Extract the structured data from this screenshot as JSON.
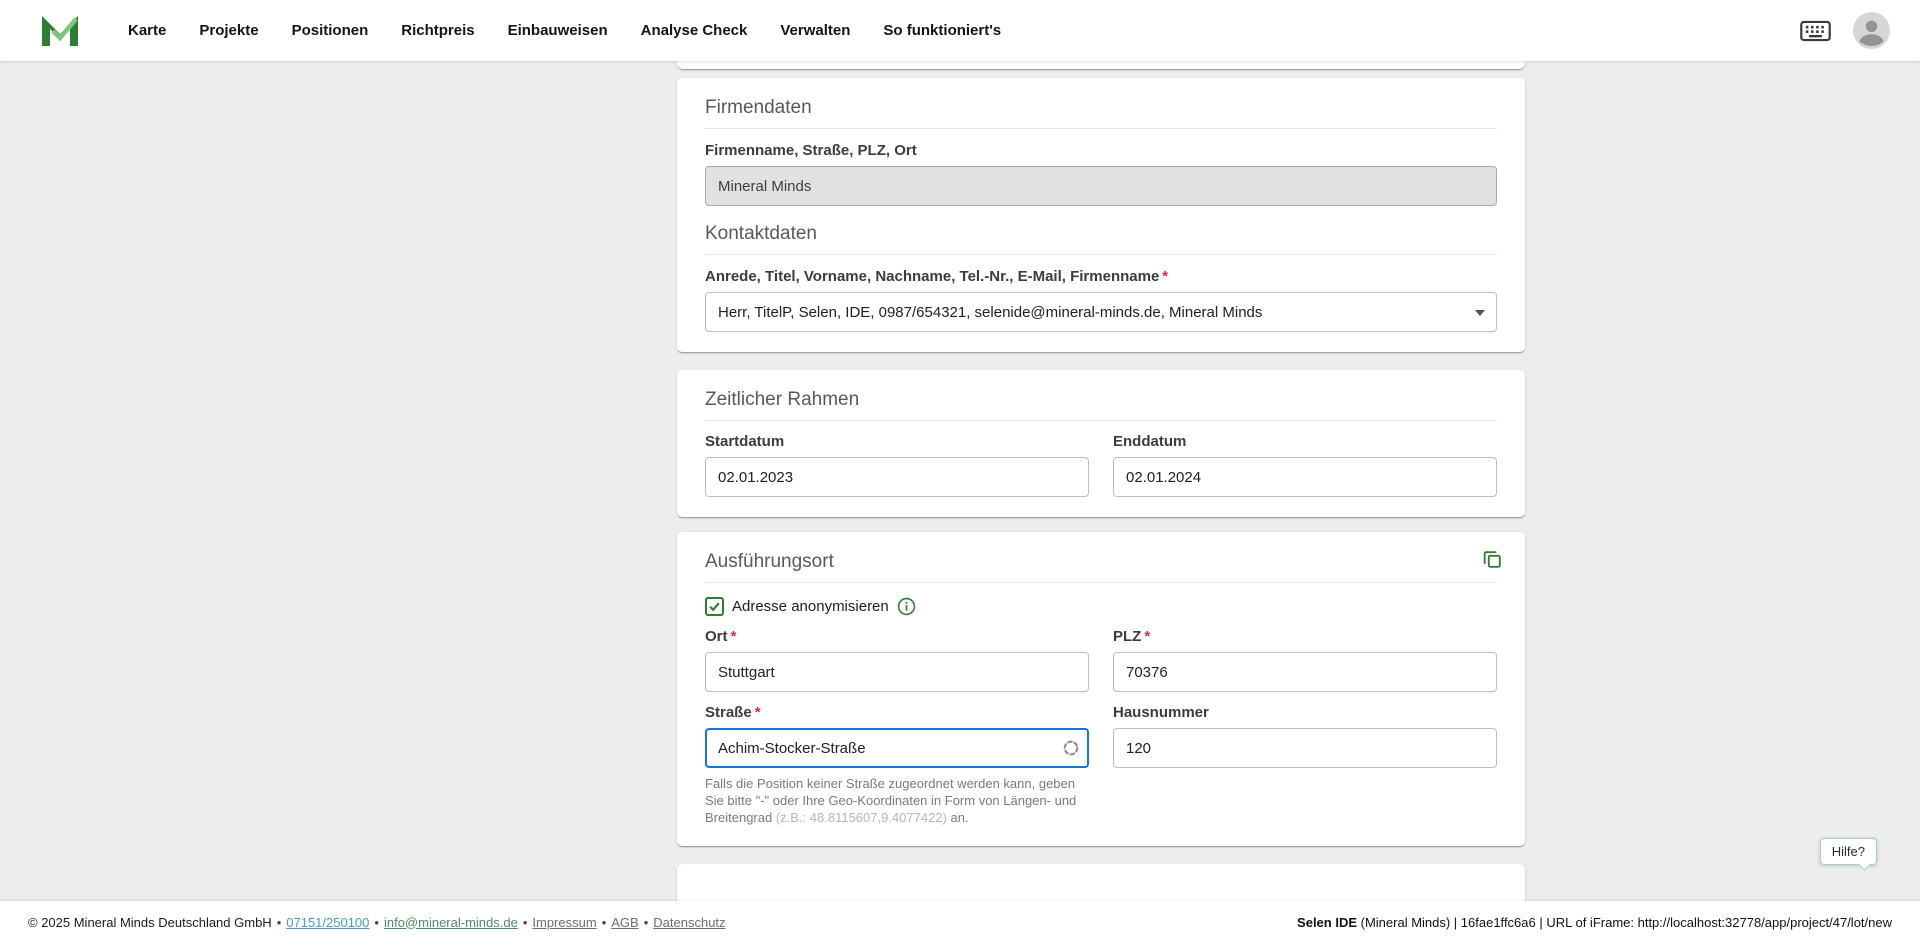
{
  "nav": {
    "items": [
      "Karte",
      "Projekte",
      "Positionen",
      "Richtpreis",
      "Einbauweisen",
      "Analyse Check",
      "Verwalten",
      "So funktioniert's"
    ]
  },
  "ui": {
    "required_marker": "*",
    "help_label": "Hilfe?"
  },
  "firmendaten": {
    "title": "Firmendaten",
    "company_label": "Firmenname, Straße, PLZ, Ort",
    "company_value": "Mineral Minds",
    "kontakt_title": "Kontaktdaten",
    "kontakt_label": "Anrede, Titel, Vorname, Nachname, Tel.-Nr., E-Mail, Firmenname",
    "kontakt_value": "Herr, TitelP, Selen, IDE, 0987/654321, selenide@mineral-minds.de, Mineral Minds"
  },
  "zeitraum": {
    "title": "Zeitlicher Rahmen",
    "start_label": "Startdatum",
    "start_value": "02.01.2023",
    "end_label": "Enddatum",
    "end_value": "02.01.2024"
  },
  "ort": {
    "title": "Ausführungsort",
    "anonym_label": "Adresse anonymisieren",
    "ort_label": "Ort",
    "ort_value": "Stuttgart",
    "plz_label": "PLZ",
    "plz_value": "70376",
    "strasse_label": "Straße",
    "strasse_value": "Achim-Stocker-Straße",
    "hausnummer_label": "Hausnummer",
    "hausnummer_value": "120",
    "helper_1": "Falls die Position keiner Straße zugeordnet werden kann, geben Sie bitte \"-\" oder Ihre Geo-Koordinaten in Form von Längen- und Breitengrad ",
    "helper_coords": "(z.B.: 48.8115607,9.4077422)",
    "helper_2": " an."
  },
  "footer": {
    "separator": "•",
    "copyright": "© 2025 Mineral Minds Deutschland GmbH",
    "phone": "07151/250100",
    "email": "info@mineral-minds.de",
    "links": [
      "Impressum",
      "AGB",
      "Datenschutz"
    ],
    "ide_bold": "Selen IDE",
    "ide_rest": " (Mineral Minds) | 16fae1ffc6a6 | URL of iFrame: http://localhost:32778/app/project/47/lot/new"
  }
}
